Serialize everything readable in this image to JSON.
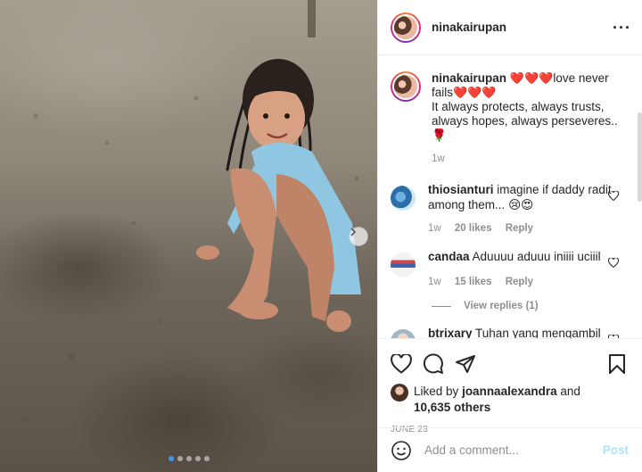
{
  "post": {
    "username": "ninakairupan",
    "more_icon": "more-horizontal-icon",
    "caption": {
      "username": "ninakairupan",
      "hearts_a": "❤️❤️❤️",
      "text_a": "love never fails",
      "hearts_b": "❤️❤️❤️",
      "text_b": "It always protects, always trusts, always hopes, always perseveres..",
      "emoji_end": "🌹",
      "time": "1w"
    },
    "comments": [
      {
        "username": "thiosianturi",
        "text": "imagine if daddy radit among them...",
        "emoji": "😢😍",
        "time": "1w",
        "likes": "20 likes",
        "reply": "Reply"
      },
      {
        "username": "candaa",
        "text": "Aduuuu aduuu iniiii uciiil",
        "emoji": "",
        "time": "1w",
        "likes": "15 likes",
        "reply": "Reply",
        "view_replies": "View replies (1)"
      },
      {
        "username": "btrixary",
        "text": "Tuhan yang mengambil"
      }
    ],
    "liked_by_prefix": "Liked by",
    "liked_by_user": "joannaalexandra",
    "liked_by_and": "and",
    "liked_by_others": "10,635 others",
    "date": "JUNE 23",
    "add_comment_placeholder": "Add a comment...",
    "post_label": "Post"
  },
  "colors": {
    "accent": "#3897f0",
    "post_disabled": "#b2dffc",
    "heart": "#e0245e",
    "muted": "#8e8e8e"
  }
}
